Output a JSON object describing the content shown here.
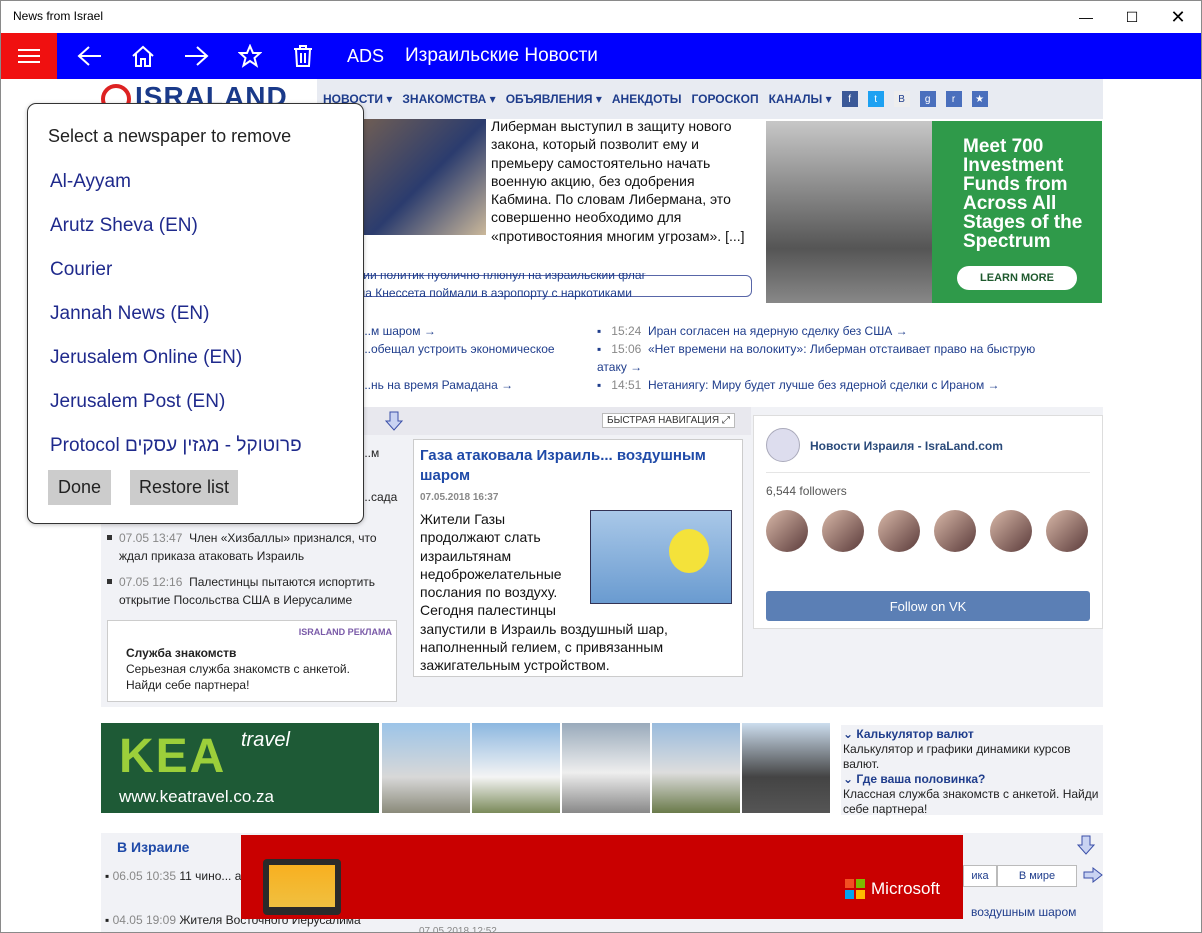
{
  "window": {
    "title": "News from Israel"
  },
  "appbar": {
    "ads": "ADS",
    "title": "Израильские Новости"
  },
  "site": {
    "logo": "ISRALAND",
    "nav": [
      "НОВОСТИ ▾",
      "ЗНАКОМСТВА ▾",
      "ОБЪЯВЛЕНИЯ ▾",
      "АНЕКДОТЫ",
      "ГОРОСКОП",
      "КАНАЛЫ ▾"
    ],
    "lead_text": "Либерман выступил в защиту нового закона, который позволит ему и премьеру самостоятельно начать военную акцию, без одобрения Кабмина. По словам Либермана, это совершенно необходимо для «противостояния многим угрозам». [...]",
    "scroll_news": [
      "...ский политик публично плюнул на израильский флаг",
      "...ена Кнессета поймали в аэропорту с наркотиками"
    ],
    "news_left": [
      "...м шаром →",
      "...обещал устроить экономическое",
      "...нь на время Рамадана →"
    ],
    "news_right": [
      {
        "time": "15:24",
        "text": "Иран согласен на ядерную сделку без США →"
      },
      {
        "time": "15:06",
        "text": "«Нет времени на волокиту»: Либерман отстаивает право на быструю атаку →"
      },
      {
        "time": "14:51",
        "text": "Нетаниягу: Миру будет лучше без ядерной сделки с Ираном →"
      }
    ],
    "quick_nav": "БЫСТРАЯ НАВИГАЦИЯ",
    "feature": {
      "title": "Газа атаковала Израиль... воздушным шаром",
      "date": "07.05.2018 16:37",
      "body": "Жители Газы продолжают слать израильтянам недоброжелательные послания по воздуху. Сегодня палестинцы запустили в Израиль воздушный шар, наполненный гелием, с привязанным зажигательным устройством."
    },
    "left_list_partial": [
      "...м",
      "...сада"
    ],
    "left_list": [
      {
        "time": "07.05 13:47",
        "text": "Член «Хизбаллы» признался, что ждал приказа атаковать Израиль"
      },
      {
        "time": "07.05 12:16",
        "text": "Палестинцы пытаются испортить открытие Посольства США в Иерусалиме"
      }
    ],
    "dating": {
      "tag": "ISRALAND РЕКЛАМА",
      "title": "Служба знакомств",
      "desc": "Серьезная служба знакомств с анкетой. Найди себе партнера!"
    },
    "vk": {
      "name": "Новости Израиля - IsraLand.com",
      "followers": "6,544 followers",
      "button": "Follow on VK"
    },
    "kea": {
      "brand": "KEA",
      "sub": "travel",
      "url": "www.keatravel.co.za"
    },
    "right_links": [
      {
        "title": "Калькулятор валют",
        "desc": "Калькулятор и графики динамики курсов валют."
      },
      {
        "title": "Где ваша половинка?",
        "desc": "Классная служба знакомств с анкетой. Найди себе партнера!"
      }
    ],
    "section2": {
      "title": "В Израиле",
      "items": [
        {
          "time": "06.05 10:35",
          "text": "11 чино... арестованы по подо..."
        },
        {
          "time": "04.05 19:09",
          "text": "Жителя Восточного Иерусалима"
        }
      ],
      "tab_world": "В мире",
      "tab_partial": "ика",
      "feat_date": "07.05.2018 12:52",
      "right_partial": "воздушным шаром"
    },
    "ms_ad": "Microsoft"
  },
  "dialog": {
    "heading": "Select a newspaper to remove",
    "options": [
      "Al-Ayyam",
      "Arutz Sheva (EN)",
      "Courier",
      "Jannah News (EN)",
      "Jerusalem Online (EN)",
      "Jerusalem Post (EN)",
      "Protocol פרוטוקל - מגזין עסקים"
    ],
    "done": "Done",
    "restore": "Restore list"
  },
  "colors": {
    "appbar": "#0000ff",
    "hamburger": "#f01010",
    "ms_ad": "#c90000"
  }
}
